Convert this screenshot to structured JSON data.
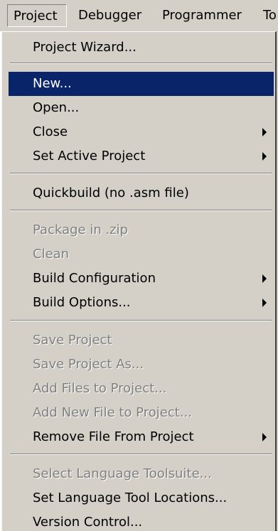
{
  "menubar": {
    "items": [
      {
        "label": "Project",
        "active": true
      },
      {
        "label": "Debugger"
      },
      {
        "label": "Programmer"
      },
      {
        "label": "To"
      }
    ]
  },
  "project_menu": {
    "project_wizard": "Project Wizard...",
    "new": "New...",
    "open": "Open...",
    "close": "Close",
    "set_active_project": "Set Active Project",
    "quickbuild": "Quickbuild (no .asm file)",
    "package_in_zip": "Package in .zip",
    "clean": "Clean",
    "build_configuration": "Build Configuration",
    "build_options": "Build Options...",
    "save_project": "Save Project",
    "save_project_as": "Save Project As...",
    "add_files_to_project": "Add Files to Project...",
    "add_new_file_to_project": "Add New File to Project...",
    "remove_file_from_project": "Remove File From Project",
    "select_language_toolsuite": "Select Language Toolsuite...",
    "set_language_tool_locations": "Set Language Tool Locations...",
    "version_control": "Version Control..."
  },
  "colors": {
    "menu_background": "#d4d0c8",
    "highlight": "#0a246a",
    "disabled_text": "#808080"
  }
}
